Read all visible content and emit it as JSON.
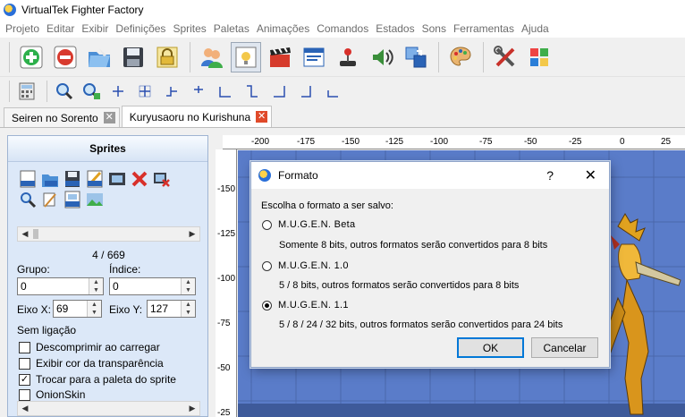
{
  "app": {
    "title": "VirtualTek Fighter Factory"
  },
  "menu": [
    "Projeto",
    "Editar",
    "Exibir",
    "Definições",
    "Sprites",
    "Paletas",
    "Animações",
    "Comandos",
    "Estados",
    "Sons",
    "Ferramentas",
    "Ajuda"
  ],
  "tabs": [
    {
      "label": "Seiren no Sorento",
      "active": false
    },
    {
      "label": "Kuryusaoru no Kurishuna",
      "active": true
    }
  ],
  "sprites_panel": {
    "title": "Sprites",
    "counter": "4 / 669",
    "group_label": "Grupo:",
    "group_value": "0",
    "index_label": "Índice:",
    "index_value": "0",
    "axis_x_label": "Eixo X:",
    "axis_x_value": "69",
    "axis_y_label": "Eixo Y:",
    "axis_y_value": "127",
    "link_label": "Sem ligação",
    "checkboxes": [
      {
        "label": "Descomprimir ao carregar",
        "checked": false
      },
      {
        "label": "Exibir cor da transparência",
        "checked": false
      },
      {
        "label": "Trocar para a paleta do sprite",
        "checked": true
      },
      {
        "label": "OnionSkin",
        "checked": false
      }
    ]
  },
  "ruler": {
    "top": [
      "-200",
      "-175",
      "-150",
      "-125",
      "-100",
      "-75",
      "-50",
      "-25",
      "0",
      "25"
    ],
    "left": [
      "-150",
      "-125",
      "-100",
      "-75",
      "-50",
      "-25"
    ]
  },
  "dialog": {
    "title": "Formato",
    "help": "?",
    "close": "✕",
    "prompt": "Escolha o formato a ser salvo:",
    "options": [
      {
        "label": "M.U.G.E.N. Beta",
        "desc": "Somente 8 bits, outros formatos serão convertidos para 8 bits",
        "selected": false
      },
      {
        "label": "M.U.G.E.N. 1.0",
        "desc": "5 / 8 bits, outros formatos serão convertidos para 8 bits",
        "selected": false
      },
      {
        "label": "M.U.G.E.N. 1.1",
        "desc": "5 / 8 / 24 / 32 bits, outros formatos serão convertidos para 24 bits",
        "selected": true
      }
    ],
    "ok_label": "OK",
    "cancel_label": "Cancelar"
  },
  "colors": {
    "stage": "#5a7cc9",
    "panel": "#dce8f8",
    "close_active": "#e04a2a"
  }
}
